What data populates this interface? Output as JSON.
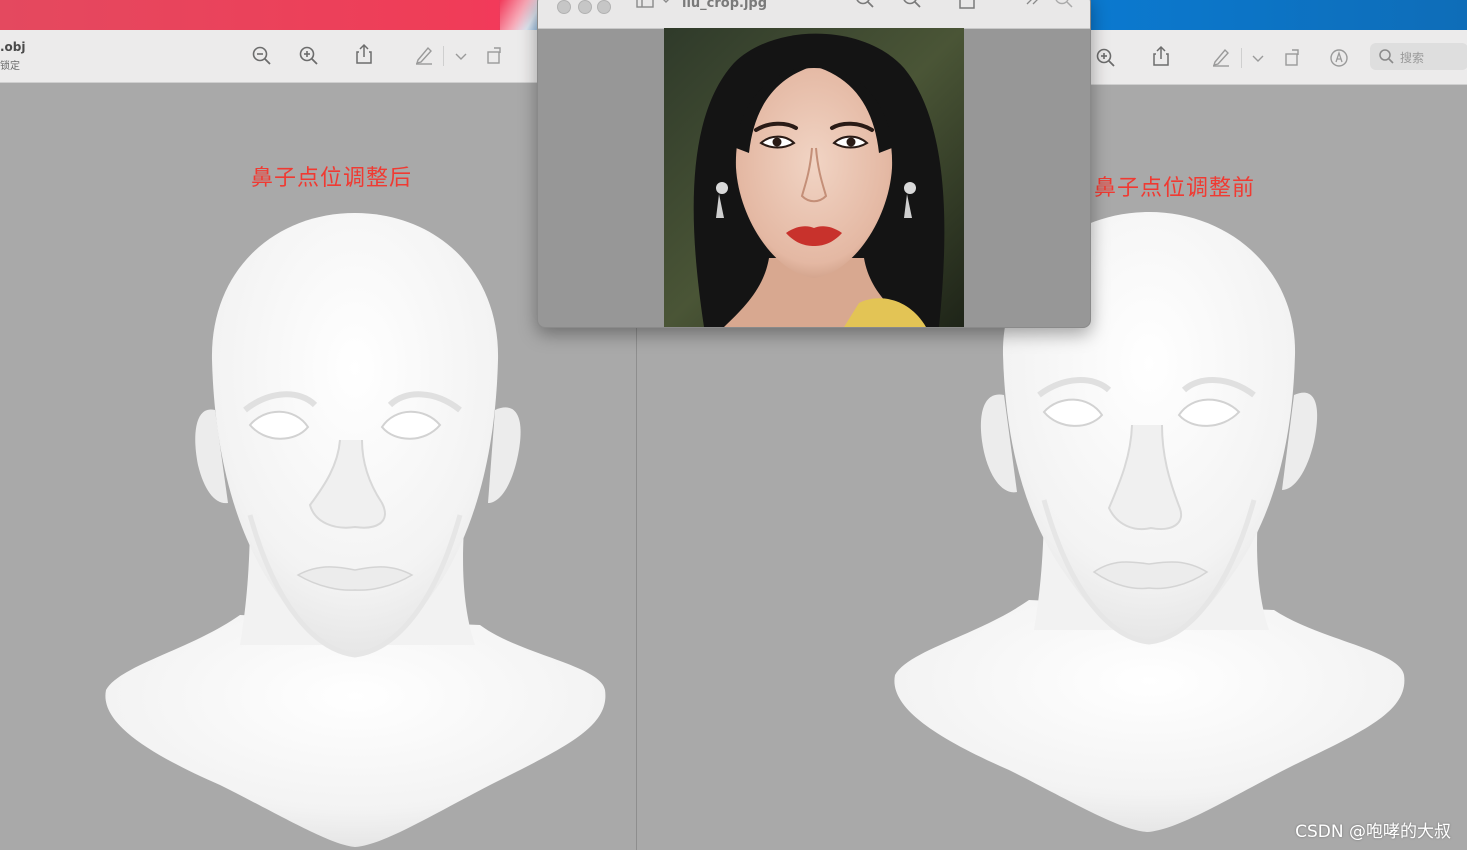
{
  "left_window": {
    "doc_title": ".obj",
    "doc_subtitle": "锁定",
    "toolbar_icons": [
      "zoom-out-icon",
      "zoom-in-icon",
      "share-icon",
      "markup-pen-icon",
      "chevron-down-icon",
      "rotate-icon"
    ]
  },
  "right_window": {
    "toolbar_icons": [
      "zoom-in-icon",
      "share-icon",
      "markup-pen-icon",
      "chevron-down-icon",
      "rotate-icon",
      "annotate-icon"
    ],
    "search": {
      "placeholder": "搜索"
    }
  },
  "photo_window": {
    "title": "liu_crop.jpg",
    "toolbar_icons": [
      "sidebar-icon",
      "zoom-out-icon",
      "zoom-in-icon",
      "share-icon",
      "more-icon",
      "search-icon"
    ]
  },
  "labels": {
    "after": "鼻子点位调整后",
    "before": "鼻子点位调整前"
  },
  "watermark": "CSDN @咆哮的大叔",
  "colors": {
    "label_red": "#f03a32",
    "canvas_gray": "#a9a9a9",
    "toolbar_gray": "#ecebeb"
  }
}
